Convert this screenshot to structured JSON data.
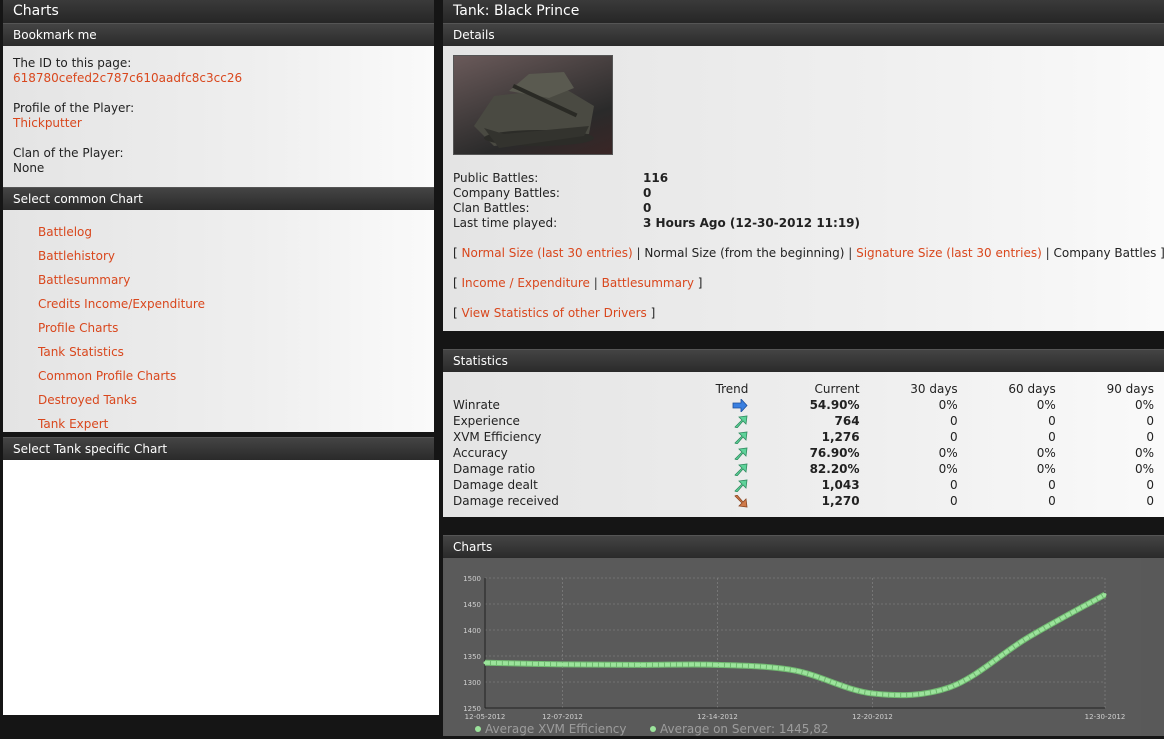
{
  "left": {
    "title": "Charts",
    "bookmark": {
      "header": "Bookmark me",
      "id_label": "The ID to this page:",
      "id_value": "618780cefed2c787c610aadfc8c3cc26",
      "profile_label": "Profile of the Player:",
      "profile_value": "Thickputter",
      "clan_label": "Clan of the Player:",
      "clan_value": "None"
    },
    "common": {
      "header": "Select common Chart",
      "items": [
        "Battlelog",
        "Battlehistory",
        "Battlesummary",
        "Credits Income/Expenditure",
        "Profile Charts",
        "Tank Statistics",
        "Common Profile Charts",
        "Destroyed Tanks",
        "Tank Expert"
      ]
    },
    "tank_specific": {
      "header": "Select Tank specific Chart"
    }
  },
  "right": {
    "title": "Tank: Black Prince",
    "details": {
      "header": "Details",
      "public_label": "Public Battles:",
      "public_value": "116",
      "company_label": "Company Battles:",
      "company_value": "0",
      "clan_label": "Clan Battles:",
      "clan_value": "0",
      "last_label": "Last time played:",
      "last_value": "3 Hours Ago (12-30-2012 11:19)",
      "links1": [
        "Normal Size (last 30 entries)",
        "Normal Size (from the beginning)",
        "Signature Size (last 30 entries)",
        "Company Battles"
      ],
      "links2": [
        "Income / Expenditure",
        "Battlesummary"
      ],
      "links3": [
        "View Statistics of other Drivers"
      ]
    },
    "statistics": {
      "header": "Statistics",
      "columns": [
        "Trend",
        "Current",
        "30 days",
        "60 days",
        "90 days"
      ],
      "rows": [
        {
          "name": "Winrate",
          "trend": "arrow-right",
          "current": "54.90%",
          "d30": "0%",
          "d60": "0%",
          "d90": "0%"
        },
        {
          "name": "Experience",
          "trend": "arrow-up",
          "current": "764",
          "d30": "0",
          "d60": "0",
          "d90": "0"
        },
        {
          "name": "XVM Efficiency",
          "trend": "arrow-up",
          "current": "1,276",
          "d30": "0",
          "d60": "0",
          "d90": "0"
        },
        {
          "name": "Accuracy",
          "trend": "arrow-up",
          "current": "76.90%",
          "d30": "0%",
          "d60": "0%",
          "d90": "0%"
        },
        {
          "name": "Damage ratio",
          "trend": "arrow-up",
          "current": "82.20%",
          "d30": "0%",
          "d60": "0%",
          "d90": "0%"
        },
        {
          "name": "Damage dealt",
          "trend": "arrow-up",
          "current": "1,043",
          "d30": "0",
          "d60": "0",
          "d90": "0"
        },
        {
          "name": "Damage received",
          "trend": "arrow-down",
          "current": "1,270",
          "d30": "0",
          "d60": "0",
          "d90": "0"
        }
      ]
    },
    "charts": {
      "header": "Charts"
    }
  },
  "colors": {
    "link": "#d9471d",
    "line": "#9be39b",
    "header_bg": "#2e2e2e",
    "chart_bg": "#5a5a5a"
  },
  "chart_data": {
    "type": "line",
    "x": [
      "12-05-2012",
      "12-07-2012",
      "12-10-2012",
      "12-14-2012",
      "12-17-2012",
      "12-20-2012",
      "12-24-2012",
      "12-27-2012",
      "12-30-2012"
    ],
    "x_ticks": [
      "12-05-2012",
      "12-07-2012",
      "12-14-2012",
      "12-20-2012",
      "12-30-2012"
    ],
    "y_ticks": [
      "1500",
      "1450",
      "1400",
      "1350",
      "1300",
      "1250"
    ],
    "series": [
      {
        "name": "Average XVM Efficiency",
        "values": [
          1337,
          1334,
          1333,
          1333,
          1322,
          1278,
          1290,
          1385,
          1468
        ]
      },
      {
        "name": "Average on Server: 1445,82"
      }
    ],
    "ylim": [
      1250,
      1500
    ],
    "grid": true,
    "legend": "bottom-left"
  }
}
